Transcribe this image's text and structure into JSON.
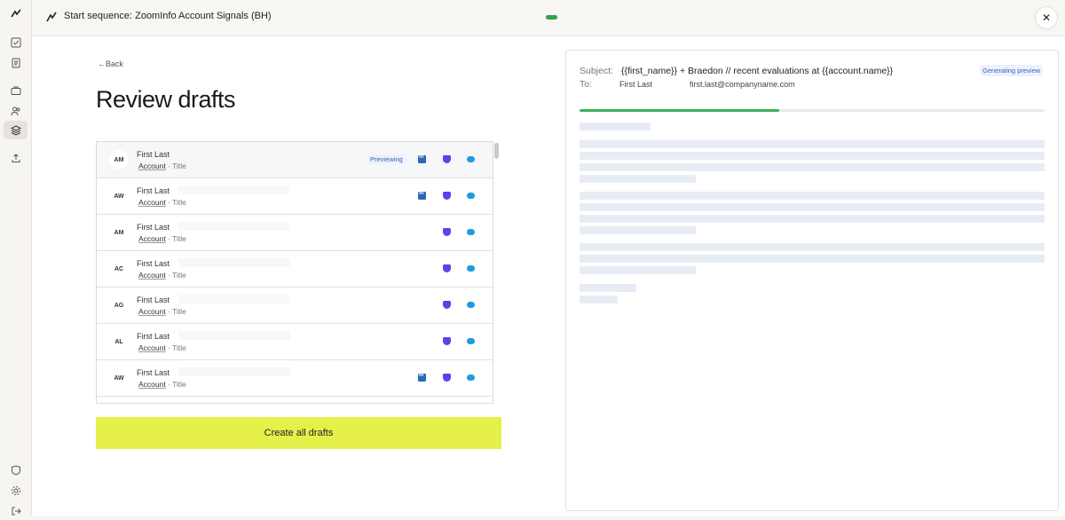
{
  "sidebar": {
    "icons": [
      "logo-icon",
      "checklist-icon",
      "document-icon",
      "briefcase-icon",
      "people-icon",
      "layers-icon",
      "upload-icon",
      "shield-icon",
      "gear-icon",
      "logout-icon"
    ]
  },
  "topbar": {
    "title": "Start sequence: ZoomInfo Account Signals (BH)",
    "close": "✕"
  },
  "page": {
    "back": "←Back",
    "title": "Review drafts",
    "cta": "Create all drafts"
  },
  "contacts": [
    {
      "initials": "AM",
      "name": "First Last",
      "account": "Account",
      "title": "Title",
      "badge": "Previewing",
      "linkedin": true
    },
    {
      "initials": "AW",
      "name": "First Last",
      "account": "Account",
      "title": "Title",
      "badge": "",
      "linkedin": true
    },
    {
      "initials": "AM",
      "name": "First Last",
      "account": "Account",
      "title": "Title",
      "badge": "",
      "linkedin": false
    },
    {
      "initials": "AC",
      "name": "First Last",
      "account": "Account",
      "title": "Title",
      "badge": "",
      "linkedin": false
    },
    {
      "initials": "AG",
      "name": "First Last",
      "account": "Account",
      "title": "Title",
      "badge": "",
      "linkedin": false
    },
    {
      "initials": "AL",
      "name": "First Last",
      "account": "Account",
      "title": "Title",
      "badge": "",
      "linkedin": false
    },
    {
      "initials": "AW",
      "name": "First Last",
      "account": "Account",
      "title": "Title",
      "badge": "",
      "linkedin": true
    }
  ],
  "separator": "·",
  "preview": {
    "subject_label": "Subject:",
    "subject": "{{first_name}} + Braedon // recent evaluations at {{account.name}}",
    "to_label": "To:",
    "to_name": "First Last",
    "to_email": "first.last@companyname.com",
    "status": "Generating preview",
    "progress": 0.43
  },
  "colors": {
    "accent": "#e5f04a",
    "progress": "#3fb25a",
    "badge_text": "#3b5dc9"
  }
}
